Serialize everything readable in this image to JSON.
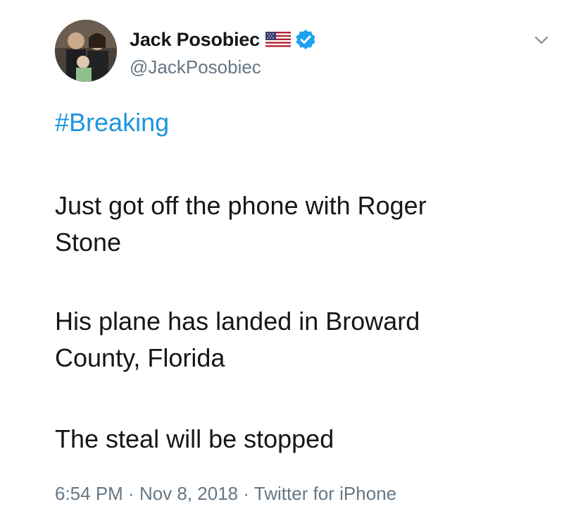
{
  "user": {
    "display_name": "Jack Posobiec",
    "handle": "@JackPosobiec",
    "flag_icon": "us-flag-icon",
    "verified_icon": "verified-badge-icon",
    "avatar_icon": "avatar-photo"
  },
  "menu_icon": "chevron-down-icon",
  "tweet": {
    "hashtag": "#Breaking",
    "line1a": "Just got off the phone with Roger",
    "line1b": "Stone",
    "line2a": "His plane has landed in Broward",
    "line2b": "County, Florida",
    "line3": "The steal will be stopped"
  },
  "meta": {
    "time": "6:54 PM",
    "sep1": " · ",
    "date": "Nov 8, 2018",
    "sep2": " · ",
    "source": "Twitter for iPhone"
  },
  "colors": {
    "link": "#1b95e0",
    "secondary": "#657786",
    "verified": "#1da1f2"
  }
}
